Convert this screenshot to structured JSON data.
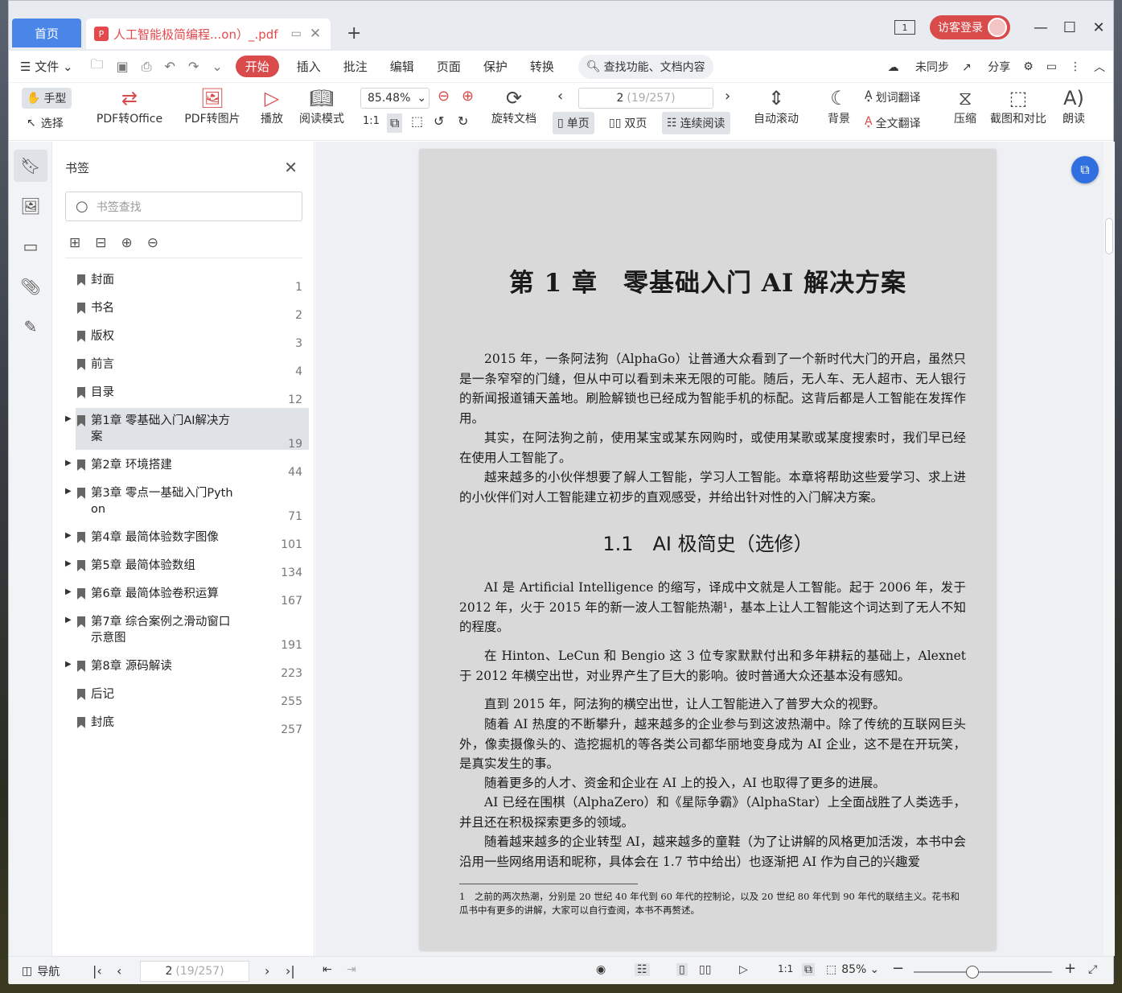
{
  "titlebar": {
    "home_tab": "首页",
    "doc_tab": "人工智能极简编程...on）_.pdf",
    "new_tab": "+",
    "page_icon": "1",
    "login": "访客登录"
  },
  "menu": {
    "file": "文件",
    "items": [
      "开始",
      "插入",
      "批注",
      "编辑",
      "页面",
      "保护",
      "转换"
    ],
    "search": "查找功能、文档内容",
    "unsync": "未同步",
    "share": "分享"
  },
  "toolbar": {
    "hand": "手型",
    "select": "选择",
    "pdf_office": "PDF转Office",
    "pdf_image": "PDF转图片",
    "play": "播放",
    "read_mode": "阅读模式",
    "zoom": "85.48%",
    "rotate": "旋转文档",
    "page_current": "2",
    "page_total": "(19/257)",
    "single": "单页",
    "double": "双页",
    "continuous": "连续阅读",
    "auto_scroll": "自动滚动",
    "background": "背景",
    "word_translate": "划词翻译",
    "full_translate": "全文翻译",
    "compress": "压缩",
    "screenshot": "截图和对比",
    "read_aloud": "朗读"
  },
  "bookmarks": {
    "title": "书签",
    "search_placeholder": "书签查找",
    "items": [
      {
        "label": "封面",
        "page": "1"
      },
      {
        "label": "书名",
        "page": "2"
      },
      {
        "label": "版权",
        "page": "3"
      },
      {
        "label": "前言",
        "page": "4"
      },
      {
        "label": "目录",
        "page": "12"
      },
      {
        "label": "第1章 零基础入门AI解决方案",
        "page": "19"
      },
      {
        "label": "第2章 环境搭建",
        "page": "44"
      },
      {
        "label": "第3章 零点一基础入门Python",
        "page": "71"
      },
      {
        "label": "第4章 最简体验数字图像",
        "page": "101"
      },
      {
        "label": "第5章 最简体验数组",
        "page": "134"
      },
      {
        "label": "第6章 最简体验卷积运算",
        "page": "167"
      },
      {
        "label": "第7章 综合案例之滑动窗口示意图",
        "page": "191"
      },
      {
        "label": "第8章 源码解读",
        "page": "223"
      },
      {
        "label": "后记",
        "page": "255"
      },
      {
        "label": "封底",
        "page": "257"
      }
    ]
  },
  "page": {
    "chapter_title": "第 1 章　零基础入门 AI 解决方案",
    "p1": "2015 年，一条阿法狗（AlphaGo）让普通大众看到了一个新时代大门的开启，虽然只是一条窄窄的门缝，但从中可以看到未来无限的可能。随后，无人车、无人超市、无人银行的新闻报道铺天盖地。刷脸解锁也已经成为智能手机的标配。这背后都是人工智能在发挥作用。",
    "p2": "其实，在阿法狗之前，使用某宝或某东网购时，或使用某歌或某度搜索时，我们早已经在使用人工智能了。",
    "p3": "越来越多的小伙伴想要了解人工智能，学习人工智能。本章将帮助这些爱学习、求上进的小伙伴们对人工智能建立初步的直观感受，并给出针对性的入门解决方案。",
    "section_title": "1.1　AI 极简史（选修）",
    "p4": "AI 是 Artificial Intelligence 的缩写，译成中文就是人工智能。起于 2006 年，发于 2012 年，火于 2015 年的新一波人工智能热潮¹，基本上让人工智能这个词达到了无人不知的程度。",
    "p5": "在 Hinton、LeCun 和 Bengio 这 3 位专家默默付出和多年耕耘的基础上，Alexnet 于 2012 年横空出世，对业界产生了巨大的影响。彼时普通大众还基本没有感知。",
    "p6": "直到 2015 年，阿法狗的横空出世，让人工智能进入了普罗大众的视野。",
    "p7": "随着 AI 热度的不断攀升，越来越多的企业参与到这波热潮中。除了传统的互联网巨头外，像卖摄像头的、造挖掘机的等各类公司都华丽地变身成为 AI 企业，这不是在开玩笑，是真实发生的事。",
    "p8": "随着更多的人才、资金和企业在 AI 上的投入，AI 也取得了更多的进展。",
    "p9": "AI 已经在围棋（AlphaZero）和《星际争霸》（AlphaStar）上全面战胜了人类选手，并且还在积极探索更多的领域。",
    "p10": "随着越来越多的企业转型 AI，越来越多的童鞋（为了让讲解的风格更加活泼，本书中会沿用一些网络用语和昵称，具体会在 1.7 节中给出）也逐渐把 AI 作为自己的兴趣爱",
    "footnote": "1　之前的两次热潮，分别是 20 世纪 40 年代到 60 年代的控制论，以及 20 世纪 80 年代到 90 年代的联结主义。花书和瓜书中有更多的讲解，大家可以自行查阅，本书不再赘述。"
  },
  "status": {
    "nav": "导航",
    "page_current": "2",
    "page_total": "(19/257)",
    "zoom": "85%"
  }
}
